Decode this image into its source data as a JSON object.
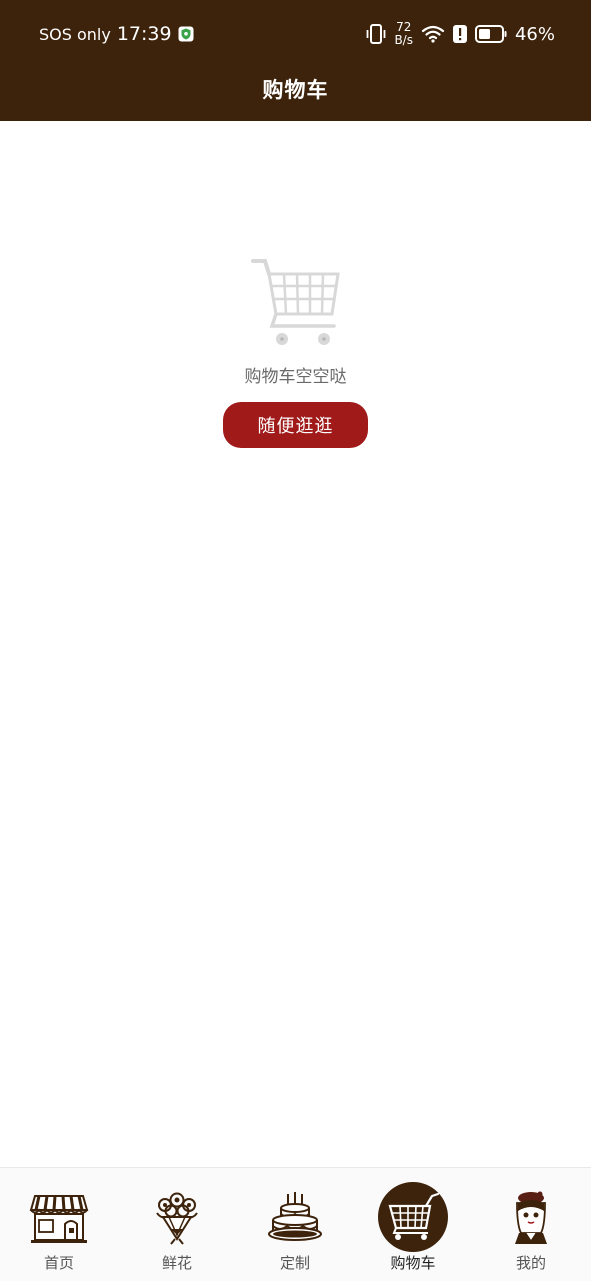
{
  "status_bar": {
    "carrier": "SOS only",
    "time": "17:39",
    "speed_value": "72",
    "speed_unit": "B/s",
    "battery": "46%",
    "icons": [
      "shield-icon",
      "vibrate-icon",
      "wifi-icon",
      "alert-icon",
      "battery-icon"
    ]
  },
  "header": {
    "title": "购物车"
  },
  "empty_state": {
    "icon": "shopping-cart-icon",
    "message": "购物车空空哒",
    "button_label": "随便逛逛"
  },
  "tabbar": {
    "active_index": 3,
    "items": [
      {
        "label": "首页",
        "icon": "storefront-icon"
      },
      {
        "label": "鲜花",
        "icon": "bouquet-icon"
      },
      {
        "label": "定制",
        "icon": "cake-icon"
      },
      {
        "label": "购物车",
        "icon": "cart-icon"
      },
      {
        "label": "我的",
        "icon": "avatar-icon"
      }
    ]
  },
  "colors": {
    "header_bg": "#3d230c",
    "button_bg": "#a01a1a",
    "tab_active_bg": "#3d230c"
  }
}
